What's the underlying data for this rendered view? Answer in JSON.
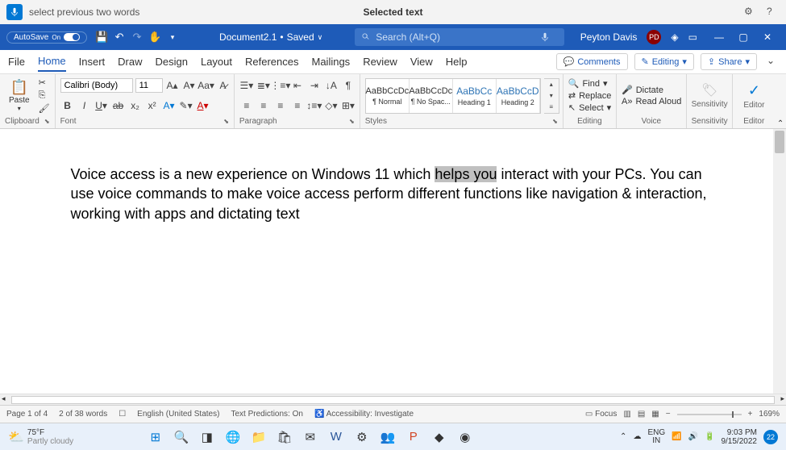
{
  "titlebar": {
    "voice_command": "select previous two words",
    "center": "Selected text"
  },
  "topbar": {
    "autosave": "AutoSave",
    "autosave_state": "On",
    "doc_name": "Document2.1",
    "save_status": "Saved",
    "search_placeholder": "Search (Alt+Q)",
    "user": "Peyton Davis",
    "user_initials": "PD"
  },
  "tabs": [
    "File",
    "Home",
    "Insert",
    "Draw",
    "Design",
    "Layout",
    "References",
    "Mailings",
    "Review",
    "View",
    "Help"
  ],
  "tab_active": 1,
  "tab_buttons": {
    "comments": "Comments",
    "editing": "Editing",
    "share": "Share"
  },
  "ribbon": {
    "clipboard": {
      "paste": "Paste",
      "label": "Clipboard"
    },
    "font": {
      "name": "Calibri (Body)",
      "size": "11",
      "label": "Font"
    },
    "paragraph": {
      "label": "Paragraph"
    },
    "styles": {
      "label": "Styles",
      "items": [
        {
          "preview": "AaBbCcDc",
          "name": "¶ Normal"
        },
        {
          "preview": "AaBbCcDc",
          "name": "¶ No Spac..."
        },
        {
          "preview": "AaBbCc",
          "name": "Heading 1",
          "h": true
        },
        {
          "preview": "AaBbCcD",
          "name": "Heading 2",
          "h": true
        }
      ]
    },
    "editing": {
      "find": "Find",
      "replace": "Replace",
      "select": "Select",
      "label": "Editing"
    },
    "voice": {
      "dictate": "Dictate",
      "read": "Read Aloud",
      "label": "Voice"
    },
    "sensitivity": {
      "btn": "Sensitivity",
      "label": "Sensitivity"
    },
    "editor": {
      "btn": "Editor",
      "label": "Editor"
    }
  },
  "document": {
    "before": "Voice access is a new experience on Windows 11 which ",
    "selected": "helps you",
    "after": " interact with your PCs. You can use voice commands to make voice access perform different functions like navigation & interaction, working with apps and dictating text"
  },
  "statusbar": {
    "page": "Page 1 of 4",
    "words": "2 of 38 words",
    "lang": "English (United States)",
    "predictions": "Text Predictions: On",
    "accessibility": "Accessibility: Investigate",
    "focus": "Focus",
    "zoom": "169%"
  },
  "taskbar": {
    "temp": "75°F",
    "weather": "Partly cloudy",
    "lang1": "ENG",
    "lang2": "IN",
    "time": "9:03 PM",
    "date": "9/15/2022",
    "notif": "22"
  }
}
